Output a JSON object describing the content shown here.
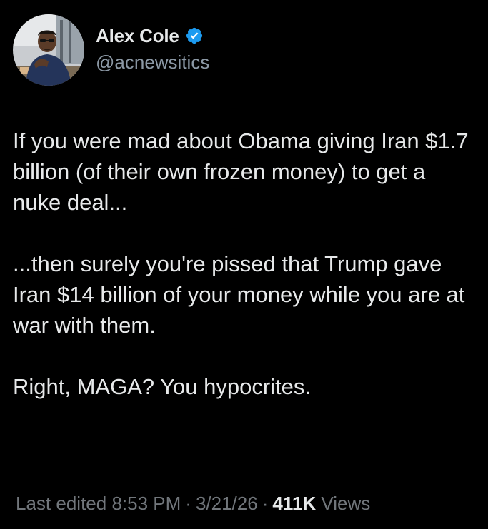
{
  "author": {
    "display_name": "Alex Cole",
    "handle": "@acnewsitics",
    "verified": true,
    "avatar_icon": "profile-photo"
  },
  "tweet": {
    "paragraphs": [
      "If you were mad about Obama giving Iran $1.7 billion (of their own frozen money) to get a nuke deal...",
      "...then surely you're pissed that Trump gave Iran $14 billion of your money while you are at war with them.",
      "Right, MAGA? You hypocrites."
    ]
  },
  "meta": {
    "edited_label": "Last edited",
    "time": "8:53 PM",
    "date": "3/21/26",
    "views_count": "411K",
    "views_label": "Views",
    "separator": "·"
  },
  "colors": {
    "background": "#000000",
    "text": "#e7e9ea",
    "secondary": "#71767b",
    "verified_badge": "#1d9bf0"
  }
}
